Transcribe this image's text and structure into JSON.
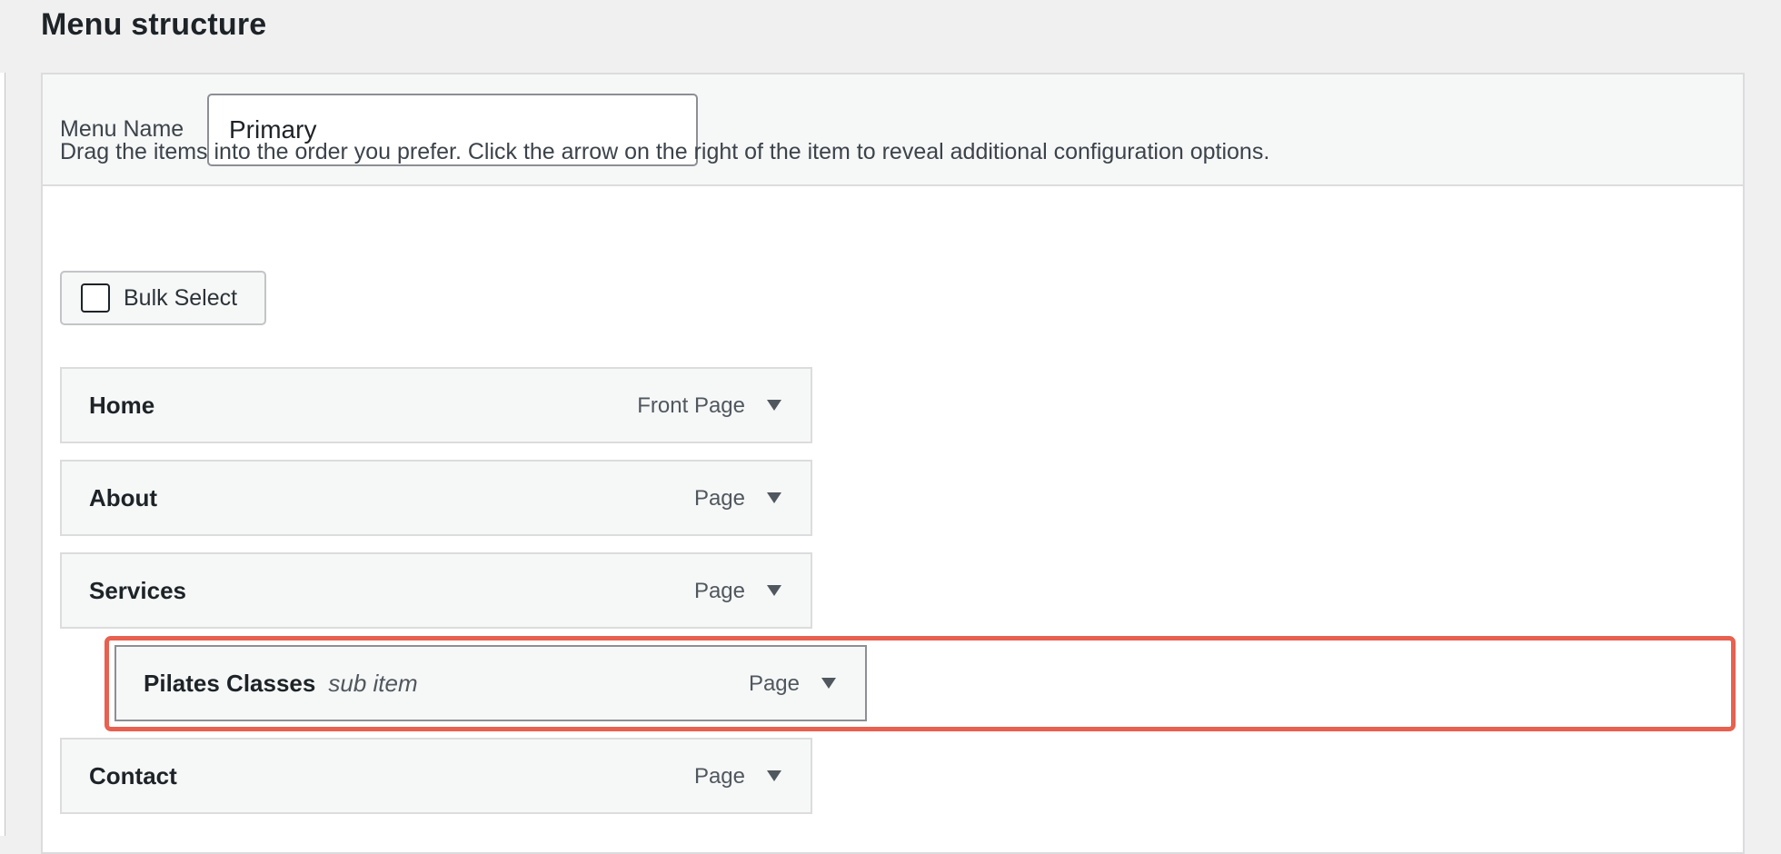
{
  "page": {
    "title": "Menu structure"
  },
  "menu": {
    "name_label": "Menu Name",
    "name_value": "Primary",
    "instructions": "Drag the items into the order you prefer. Click the arrow on the right of the item to reveal additional configuration options.",
    "bulk_select_label": "Bulk Select",
    "items": [
      {
        "title": "Home",
        "type": "Front Page",
        "sublabel": ""
      },
      {
        "title": "About",
        "type": "Page",
        "sublabel": ""
      },
      {
        "title": "Services",
        "type": "Page",
        "sublabel": ""
      },
      {
        "title": "Pilates Classes",
        "type": "Page",
        "sublabel": "sub item"
      },
      {
        "title": "Contact",
        "type": "Page",
        "sublabel": ""
      }
    ]
  },
  "colors": {
    "highlight": "#e8604f",
    "item_background": "#f6f7f7",
    "text_primary": "#1d2327",
    "text_secondary": "#50575e"
  },
  "icons": {
    "item_toggle": "triangle-down-icon"
  }
}
